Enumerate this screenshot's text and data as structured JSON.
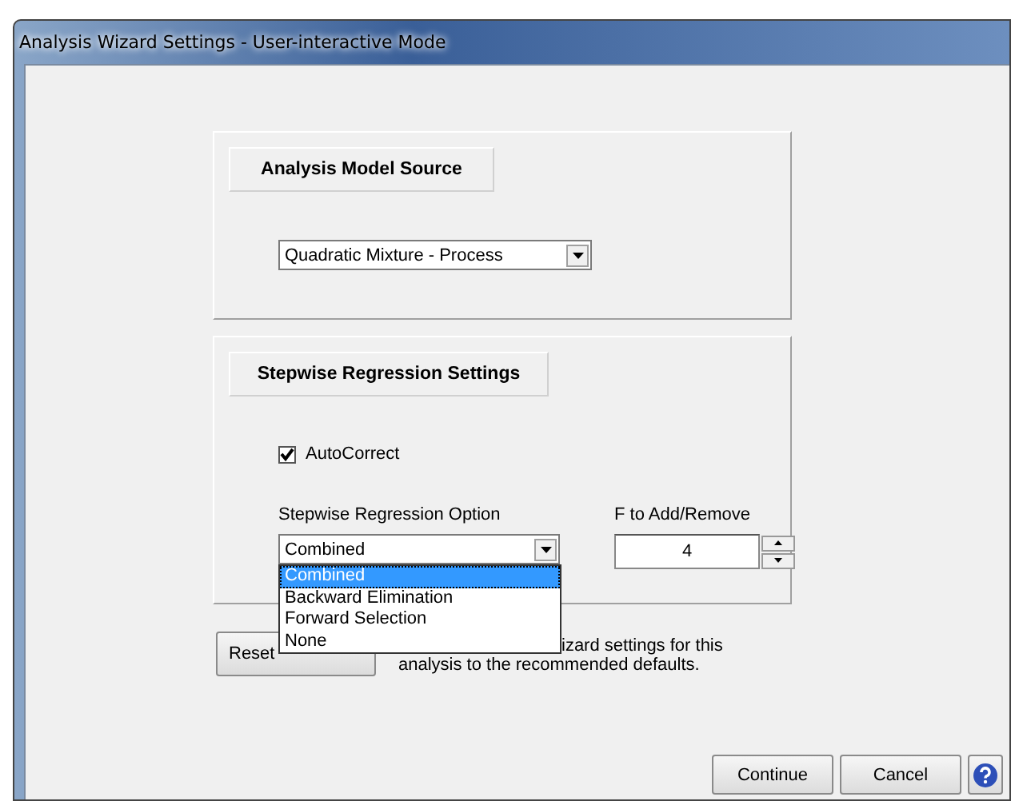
{
  "window": {
    "title": "Analysis Wizard Settings - User-interactive Mode"
  },
  "model_source": {
    "heading": "Analysis Model Source",
    "value": "Quadratic Mixture - Process"
  },
  "stepwise": {
    "heading": "Stepwise Regression Settings",
    "autocorrect": {
      "label": "AutoCorrect",
      "checked": true
    },
    "option": {
      "label": "Stepwise Regression Option",
      "value": "Combined",
      "expanded": true,
      "items": [
        {
          "label": "Combined",
          "selected": true
        },
        {
          "label": "Backward Elimination",
          "selected": false
        },
        {
          "label": "Forward Selection",
          "selected": false
        },
        {
          "label": "None",
          "selected": false
        }
      ]
    },
    "f_value": {
      "label": "F to Add/Remove",
      "value": "4"
    }
  },
  "reset": {
    "button": "Reset",
    "description_line_1": "izard settings for this",
    "description_line_2": "analysis to the recommended defaults."
  },
  "buttons": [
    "Continue",
    "Cancel"
  ]
}
